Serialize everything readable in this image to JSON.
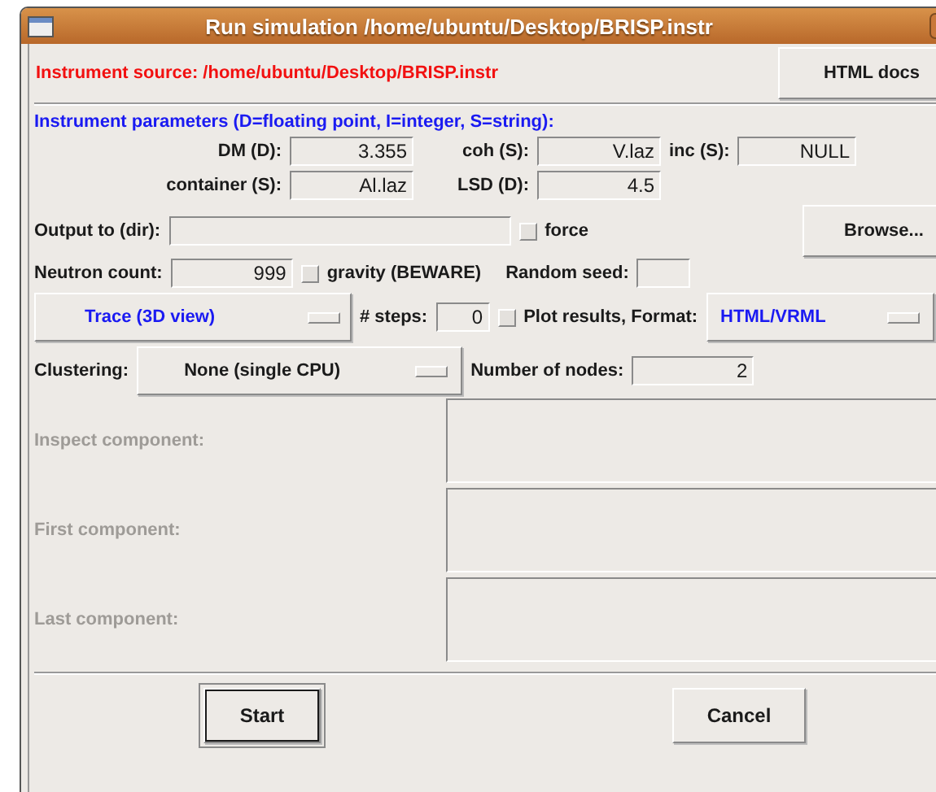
{
  "window": {
    "title": "Run simulation /home/ubuntu/Desktop/BRISP.instr"
  },
  "source": {
    "label": "Instrument source: /home/ubuntu/Desktop/BRISP.instr",
    "button": "HTML docs"
  },
  "parameters": {
    "heading": "Instrument parameters (D=floating point, I=integer, S=string):",
    "rows": [
      [
        {
          "label": "DM (D):",
          "value": "3.355"
        },
        {
          "label": "coh (S):",
          "value": "V.laz"
        },
        {
          "label": "inc (S):",
          "value": "NULL"
        }
      ],
      [
        {
          "label": "container (S):",
          "value": "Al.laz"
        },
        {
          "label": "LSD (D):",
          "value": "4.5"
        }
      ]
    ]
  },
  "output": {
    "label": "Output to (dir):",
    "force": {
      "label": "force",
      "checked": false
    },
    "button": "Browse..."
  },
  "neutron_count": {
    "label": "Neutron count:",
    "value": "999"
  },
  "gravity": {
    "label": "gravity (BEWARE)",
    "checked": false
  },
  "random_seed": {
    "label": "Random seed:"
  },
  "mode": {
    "value": "Trace (3D view)"
  },
  "steps": {
    "label": "# steps:",
    "value": "0"
  },
  "plot": {
    "label": "Plot results, Format:",
    "checked": false,
    "format": "HTML/VRML"
  },
  "clustering": {
    "label": "Clustering:",
    "value": "None (single CPU)"
  },
  "nodes": {
    "label": "Number of nodes:",
    "value": "2"
  },
  "components": [
    {
      "label": "Inspect component:",
      "disabled": true
    },
    {
      "label": "First component:",
      "disabled": true
    },
    {
      "label": "Last component:",
      "disabled": true
    }
  ],
  "buttons": [
    {
      "label": "Start",
      "default": true
    },
    {
      "label": "Cancel",
      "default": false
    }
  ]
}
